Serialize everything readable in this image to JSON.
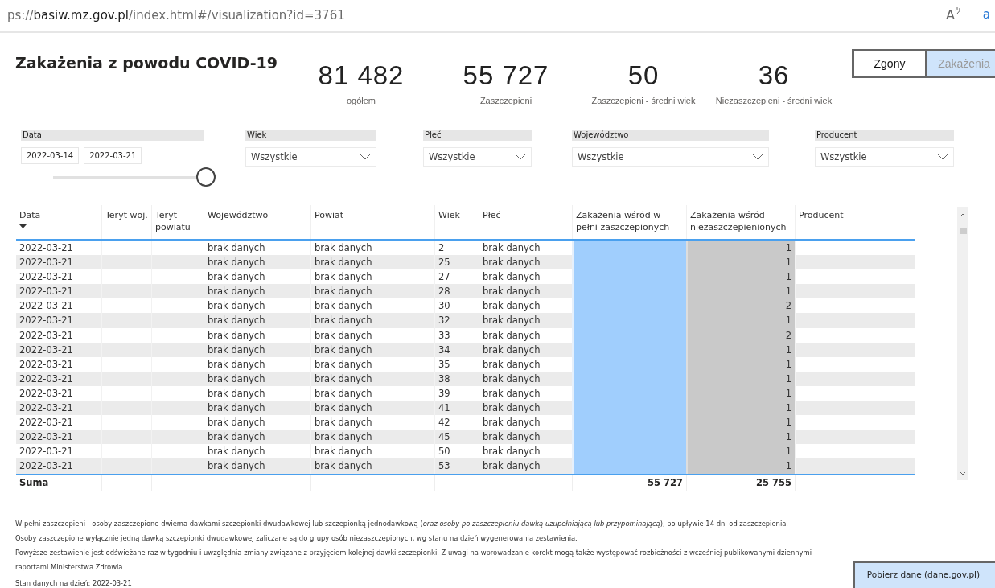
{
  "browser": {
    "url_prefix": "ps://",
    "url_domain": "basiw.mz.gov.pl",
    "url_path": "/index.html#/visualization?id=3761",
    "read_aloud": "A",
    "translate": "a"
  },
  "title": "Zakażenia z powodu COVID-19",
  "kpis": [
    {
      "value": "81 482",
      "label": "ogółem"
    },
    {
      "value": "55 727",
      "label": "Zaszczepieni"
    },
    {
      "value": "50",
      "label": "Zaszczepieni - średni wiek"
    },
    {
      "value": "36",
      "label": "Niezaszczepieni - średni wiek"
    }
  ],
  "page_toggle": [
    {
      "label": "Zgony",
      "selected": false
    },
    {
      "label": "Zakażenia",
      "selected": true
    }
  ],
  "date_filter": {
    "label": "Data",
    "from": "2022-03-14",
    "to": "2022-03-21",
    "level": 1
  },
  "filters": [
    {
      "label": "Wiek",
      "value": "Wszystkie"
    },
    {
      "label": "Płeć",
      "value": "Wszystkie"
    },
    {
      "label": "Województwo",
      "value": "Wszystkie"
    },
    {
      "label": "Producent",
      "value": "Wszystkie"
    }
  ],
  "table": {
    "columns": [
      {
        "label": "Data",
        "sorted_descending": true
      },
      {
        "label": "Teryt woj.",
        "sorted_descending": false
      },
      {
        "label": "Teryt powiatu",
        "sorted_descending": false
      },
      {
        "label": "Województwo",
        "sorted_descending": false
      },
      {
        "label": "Powiat",
        "sorted_descending": false
      },
      {
        "label": "Wiek",
        "sorted_descending": false
      },
      {
        "label": "Płeć",
        "sorted_descending": false
      },
      {
        "label": "Zakażenia wśród w pełni zaszczepionych",
        "sorted_descending": false
      },
      {
        "label": "Zakażenia wśród niezaszczepienionych",
        "sorted_descending": false
      },
      {
        "label": "Producent",
        "sorted_descending": false
      }
    ],
    "rows": [
      [
        "2022-03-21",
        "",
        "",
        "brak danych",
        "brak danych",
        "2",
        "brak danych",
        "",
        "1",
        ""
      ],
      [
        "2022-03-21",
        "",
        "",
        "brak danych",
        "brak danych",
        "25",
        "brak danych",
        "",
        "1",
        ""
      ],
      [
        "2022-03-21",
        "",
        "",
        "brak danych",
        "brak danych",
        "27",
        "brak danych",
        "",
        "1",
        ""
      ],
      [
        "2022-03-21",
        "",
        "",
        "brak danych",
        "brak danych",
        "28",
        "brak danych",
        "",
        "1",
        ""
      ],
      [
        "2022-03-21",
        "",
        "",
        "brak danych",
        "brak danych",
        "30",
        "brak danych",
        "",
        "2",
        ""
      ],
      [
        "2022-03-21",
        "",
        "",
        "brak danych",
        "brak danych",
        "32",
        "brak danych",
        "",
        "1",
        ""
      ],
      [
        "2022-03-21",
        "",
        "",
        "brak danych",
        "brak danych",
        "33",
        "brak danych",
        "",
        "2",
        ""
      ],
      [
        "2022-03-21",
        "",
        "",
        "brak danych",
        "brak danych",
        "34",
        "brak danych",
        "",
        "1",
        ""
      ],
      [
        "2022-03-21",
        "",
        "",
        "brak danych",
        "brak danych",
        "35",
        "brak danych",
        "",
        "1",
        ""
      ],
      [
        "2022-03-21",
        "",
        "",
        "brak danych",
        "brak danych",
        "38",
        "brak danych",
        "",
        "1",
        ""
      ],
      [
        "2022-03-21",
        "",
        "",
        "brak danych",
        "brak danych",
        "39",
        "brak danych",
        "",
        "1",
        ""
      ],
      [
        "2022-03-21",
        "",
        "",
        "brak danych",
        "brak danych",
        "41",
        "brak danych",
        "",
        "1",
        ""
      ],
      [
        "2022-03-21",
        "",
        "",
        "brak danych",
        "brak danych",
        "42",
        "brak danych",
        "",
        "1",
        ""
      ],
      [
        "2022-03-21",
        "",
        "",
        "brak danych",
        "brak danych",
        "45",
        "brak danych",
        "",
        "1",
        ""
      ],
      [
        "2022-03-21",
        "",
        "",
        "brak danych",
        "brak danych",
        "50",
        "brak danych",
        "",
        "1",
        ""
      ],
      [
        "2022-03-21",
        "",
        "",
        "brak danych",
        "brak danych",
        "53",
        "brak danych",
        "",
        "1",
        ""
      ]
    ],
    "total": {
      "label": "Suma",
      "vaccinated": "55 727",
      "unvaccinated": "25 755"
    }
  },
  "notes": [
    "W pełni zaszczepieni - osoby zaszczepione dwiema dawkami szczepionki dwudawkowej lub szczepionką jednodawkową (*oraz osoby po zaszczepieniu dawką uzupełniającą lub przypominającą*), po upływie 14 dni od zaszczepienia.",
    "Osoby zaszczepione wyłącznie jedną dawką szczepionki dwudawkowej zaliczane są do grupy osób niezaszczepionych, wg stanu na dzień wygenerowania zestawienia.",
    "Powyższe zestawienie jest odświeżane raz w tygodniu i uwzględnia zmiany związane z przyjęciem kolejnej dawki szczepionki. Z uwagi na wprowadzanie korekt mogą także występować rozbieżności z wcześniej publikowanymi dziennymi raportami Ministerstwa Zdrowia."
  ],
  "data_date": "Stan danych na dzień: 2022-03-21",
  "download_button": "Pobierz dane (dane.gov.pl)"
}
